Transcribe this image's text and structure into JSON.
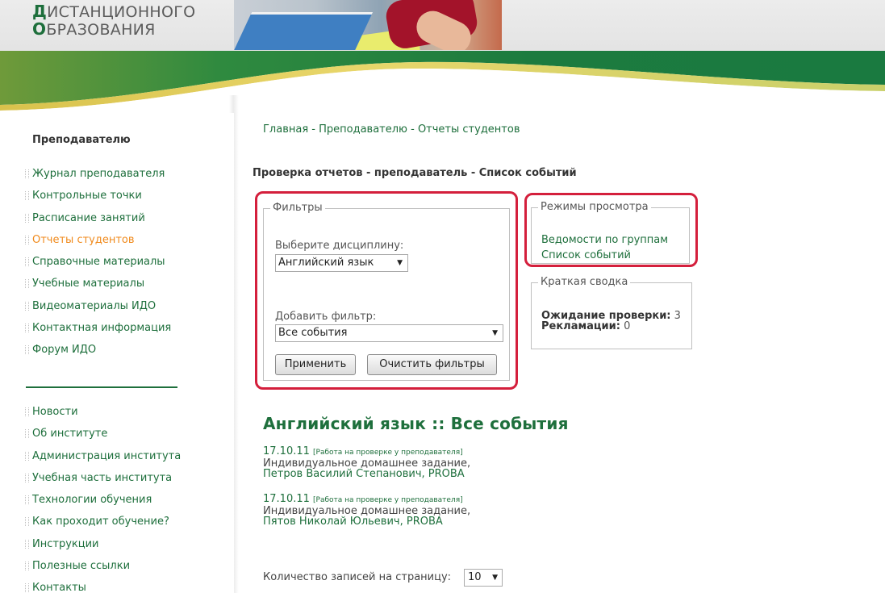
{
  "header": {
    "logo_line1_initial": "Д",
    "logo_line1_rest": "ИСТАНЦИОННОГО",
    "logo_line2_initial": "О",
    "logo_line2_rest": "БРАЗОВАНИЯ",
    "right_text": "•••••"
  },
  "sidebar": {
    "title": "Преподавателю",
    "items_primary": [
      {
        "label": "Журнал преподавателя",
        "active": false
      },
      {
        "label": "Контрольные точки",
        "active": false
      },
      {
        "label": "Расписание занятий",
        "active": false
      },
      {
        "label": "Отчеты студентов",
        "active": true
      },
      {
        "label": "Справочные материалы",
        "active": false
      },
      {
        "label": "Учебные материалы",
        "active": false
      },
      {
        "label": "Видеоматериалы ИДО",
        "active": false
      },
      {
        "label": "Контактная информация",
        "active": false
      },
      {
        "label": "Форум ИДО",
        "active": false
      }
    ],
    "items_secondary": [
      {
        "label": "Новости"
      },
      {
        "label": "Об институте"
      },
      {
        "label": "Администрация института"
      },
      {
        "label": "Учебная часть института"
      },
      {
        "label": "Технологии обучения"
      },
      {
        "label": "Как проходит обучение?"
      },
      {
        "label": "Инструкции"
      },
      {
        "label": "Полезные ссылки"
      },
      {
        "label": "Контакты"
      }
    ]
  },
  "main": {
    "breadcrumb": "Главная - Преподавателю - Отчеты студентов",
    "subtitle": "Проверка отчетов - преподаватель - Список событий",
    "filters": {
      "legend": "Фильтры",
      "discipline_label": "Выберите дисциплину:",
      "discipline_value": "Английский язык",
      "add_filter_label": "Добавить фильтр:",
      "add_filter_value": "Все события",
      "apply_button": "Применить",
      "clear_button": "Очистить фильтры"
    },
    "view_modes": {
      "legend": "Режимы просмотра",
      "by_groups": "Ведомости по группам",
      "event_list": "Список событий"
    },
    "summary": {
      "legend": "Краткая сводка",
      "pending_label": "Ожидание проверки:",
      "pending_value": "3",
      "claims_label": "Рекламации:",
      "claims_value": "0"
    },
    "section_title": "Английский язык :: Все события",
    "events": [
      {
        "date": "17.10.11",
        "status": "[Работа на проверке у преподавателя]",
        "description": "Индивидуальное домашнее задание,",
        "student": "Петров Василий Степанович, PROBA"
      },
      {
        "date": "17.10.11",
        "status": "[Работа на проверке у преподавателя]",
        "description": "Индивидуальное домашнее задание,",
        "student": "Пятов Николай Юльевич, PROBA"
      }
    ],
    "per_page_label": "Количество записей на страницу:",
    "per_page_value": "10"
  },
  "colors": {
    "brand_green": "#1e6f3c",
    "active_orange": "#f08a1c",
    "highlight_red": "#d41f3c"
  }
}
